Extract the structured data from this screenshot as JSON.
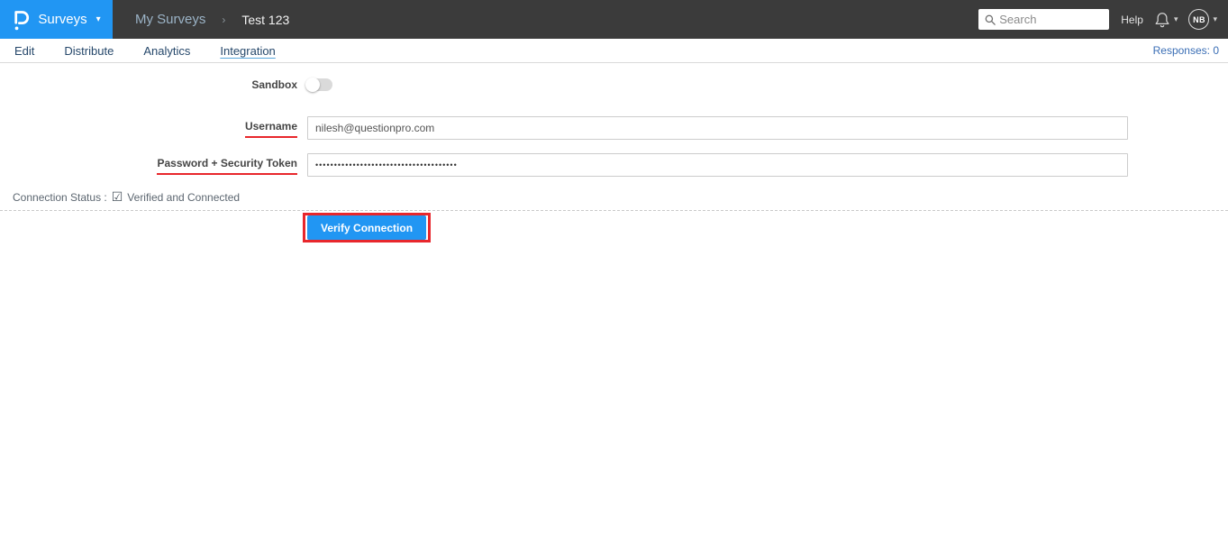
{
  "header": {
    "brand": {
      "logo_icon": "questionpro-p-logo",
      "menu_label": "Surveys",
      "caret": "▾"
    },
    "breadcrumb": {
      "parent": "My Surveys",
      "separator": "›",
      "current": "Test 123"
    },
    "search": {
      "placeholder": "Search",
      "icon": "search-icon"
    },
    "help_label": "Help",
    "notifications": {
      "icon": "bell-icon",
      "caret": "▾"
    },
    "account": {
      "initials": "NB",
      "caret": "▾"
    }
  },
  "tabs": {
    "items": [
      {
        "label": "Edit",
        "active": false
      },
      {
        "label": "Distribute",
        "active": false
      },
      {
        "label": "Analytics",
        "active": false
      },
      {
        "label": "Integration",
        "active": true
      }
    ],
    "responses_label": "Responses: 0"
  },
  "form": {
    "sandbox": {
      "label": "Sandbox",
      "enabled": false
    },
    "username": {
      "label": "Username",
      "value": "nilesh@questionpro.com"
    },
    "password": {
      "label": "Password + Security Token",
      "value": "••••••••••••••••••••••••••••••••••••••"
    },
    "connection_status": {
      "label": "Connection Status :",
      "check_glyph": "☑",
      "value": "Verified and Connected"
    },
    "verify_button_label": "Verify Connection"
  },
  "colors": {
    "header_bg": "#3b3b3b",
    "brand_blue": "#2196f3",
    "breadcrumb_parent": "#9bb3c6",
    "tab_text": "#25476a",
    "tab_underline": "#58a6dc",
    "responses_text": "#3a6eb5",
    "annotation_red": "#e8272c",
    "button_blue": "#2196f3",
    "input_border": "#cccccc"
  }
}
